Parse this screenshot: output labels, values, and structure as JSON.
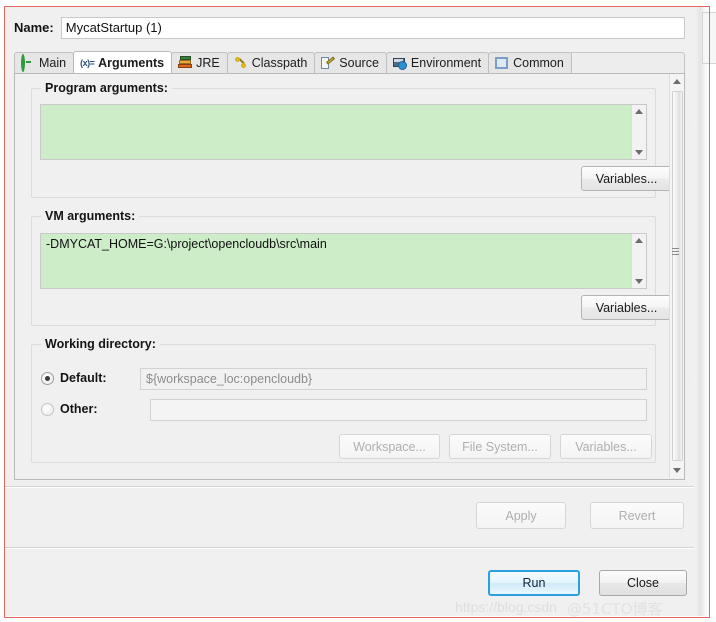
{
  "dialog": {
    "name_label": "Name:",
    "name_value": "MycatStartup (1)"
  },
  "tabs": [
    {
      "label": "Main",
      "icon": "green-circle-arrow-icon",
      "selected": false
    },
    {
      "label": "Arguments",
      "icon": "arguments-xx-icon",
      "selected": true
    },
    {
      "label": "JRE",
      "icon": "jre-books-icon",
      "selected": false
    },
    {
      "label": "Classpath",
      "icon": "classpath-links-icon",
      "selected": false
    },
    {
      "label": "Source",
      "icon": "source-pencil-icon",
      "selected": false
    },
    {
      "label": "Environment",
      "icon": "environment-monitor-icon",
      "selected": false
    },
    {
      "label": "Common",
      "icon": "common-window-icon",
      "selected": false
    }
  ],
  "program_arguments": {
    "title": "Program arguments:",
    "value": "",
    "variables_button": "Variables..."
  },
  "vm_arguments": {
    "title": "VM arguments:",
    "value": "-DMYCAT_HOME=G:\\project\\opencloudb\\src\\main",
    "variables_button": "Variables..."
  },
  "working_directory": {
    "title": "Working directory:",
    "default_label": "Default:",
    "default_value": "${workspace_loc:opencloudb}",
    "default_selected": true,
    "other_label": "Other:",
    "other_value": "",
    "other_selected": false,
    "workspace_button": "Workspace...",
    "file_system_button": "File System...",
    "variables_button": "Variables..."
  },
  "footer": {
    "apply_button": "Apply",
    "revert_button": "Revert",
    "run_button": "Run",
    "close_button": "Close"
  },
  "watermark": {
    "url_text": "https://blog.csdn",
    "site_text": "@51CTO博客"
  },
  "colors": {
    "textarea_background": "#cdecc8",
    "accent_focus": "#2b9fe0",
    "annotation_border": "#e06a62"
  }
}
